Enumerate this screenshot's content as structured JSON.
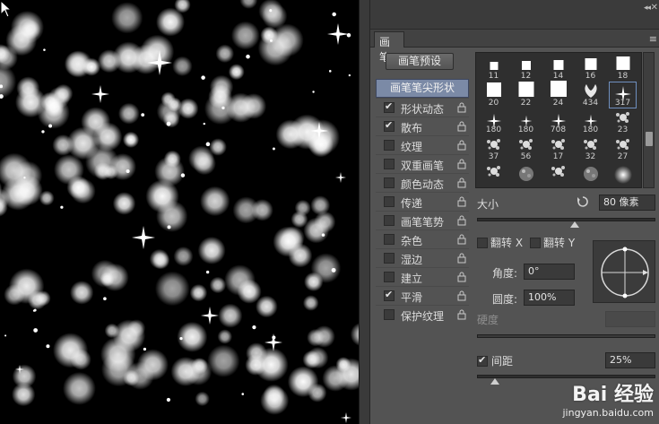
{
  "panel": {
    "tab_label": "画笔",
    "collapse_glyph": "◂◂",
    "close_glyph": "✕",
    "menu_glyph": "≡",
    "preset_button": "画笔预设"
  },
  "options": [
    {
      "label": "画笔笔尖形状",
      "header": true
    },
    {
      "label": "形状动态",
      "checked": true,
      "lock": true
    },
    {
      "label": "散布",
      "checked": true,
      "lock": true
    },
    {
      "label": "纹理",
      "checked": false,
      "lock": true
    },
    {
      "label": "双重画笔",
      "checked": false,
      "lock": true
    },
    {
      "label": "颜色动态",
      "checked": false,
      "lock": true
    },
    {
      "label": "传递",
      "checked": false,
      "lock": true
    },
    {
      "label": "画笔笔势",
      "checked": false,
      "lock": true
    },
    {
      "label": "杂色",
      "checked": false,
      "lock": true
    },
    {
      "label": "湿边",
      "checked": false,
      "lock": true
    },
    {
      "label": "建立",
      "checked": false,
      "lock": true
    },
    {
      "label": "平滑",
      "checked": true,
      "lock": true
    },
    {
      "label": "保护纹理",
      "checked": false,
      "lock": true
    }
  ],
  "brush_presets": [
    {
      "num": "11",
      "kind": "square",
      "s": 9
    },
    {
      "num": "12",
      "kind": "square",
      "s": 10
    },
    {
      "num": "14",
      "kind": "square",
      "s": 11
    },
    {
      "num": "16",
      "kind": "square",
      "s": 13
    },
    {
      "num": "18",
      "kind": "square",
      "s": 15
    },
    {
      "num": "20",
      "kind": "square",
      "s": 16
    },
    {
      "num": "22",
      "kind": "square",
      "s": 17
    },
    {
      "num": "24",
      "kind": "square",
      "s": 18
    },
    {
      "num": "434",
      "kind": "leaf",
      "s": 14
    },
    {
      "num": "317",
      "kind": "star",
      "s": 10,
      "selected": true
    },
    {
      "num": "180",
      "kind": "star",
      "s": 9
    },
    {
      "num": "180",
      "kind": "star",
      "s": 7
    },
    {
      "num": "708",
      "kind": "star",
      "s": 9
    },
    {
      "num": "180",
      "kind": "star",
      "s": 8
    },
    {
      "num": "23",
      "kind": "splat",
      "s": 10
    },
    {
      "num": "37",
      "kind": "splat",
      "s": 11
    },
    {
      "num": "56",
      "kind": "splat",
      "s": 11
    },
    {
      "num": "17",
      "kind": "splat",
      "s": 10
    },
    {
      "num": "32",
      "kind": "splat",
      "s": 11
    },
    {
      "num": "27",
      "kind": "splat",
      "s": 11
    },
    {
      "num": "",
      "kind": "splat",
      "s": 11
    },
    {
      "num": "",
      "kind": "noise",
      "s": 13
    },
    {
      "num": "",
      "kind": "splat",
      "s": 11
    },
    {
      "num": "",
      "kind": "noise",
      "s": 13
    },
    {
      "num": "",
      "kind": "soft",
      "s": 14
    }
  ],
  "size": {
    "label": "大小",
    "value": "80 像素",
    "slider_fraction": 0.55
  },
  "flip_x": {
    "label": "翻转 X",
    "checked": false
  },
  "flip_y": {
    "label": "翻转 Y",
    "checked": false
  },
  "angle": {
    "label": "角度:",
    "value": "0°"
  },
  "roundness": {
    "label": "圆度:",
    "value": "100%"
  },
  "hardness": {
    "label": "硬度"
  },
  "spacing": {
    "label": "间距",
    "checked": true,
    "value": "25%",
    "slider_fraction": 0.1
  },
  "watermark": {
    "logo": "Bai 经验",
    "url": "jingyan.baidu.com"
  }
}
